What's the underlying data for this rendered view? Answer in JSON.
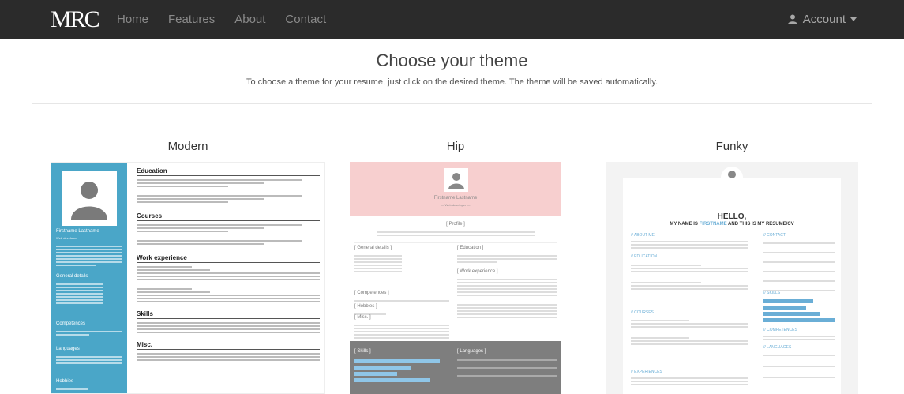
{
  "nav": {
    "brand": "MRC",
    "links": [
      "Home",
      "Features",
      "About",
      "Contact"
    ],
    "account_label": "Account"
  },
  "header": {
    "title": "Choose your theme",
    "subtitle": "To choose a theme for your resume, just click on the desired theme. The theme will be saved automatically."
  },
  "themes": [
    {
      "name": "Modern",
      "preview": {
        "name": "Firstname Lastname",
        "role": "Web developer",
        "sections": [
          "Education",
          "Courses",
          "Work experience",
          "Skills",
          "Misc."
        ],
        "side_sections": [
          "General details",
          "Competences",
          "Languages",
          "Hobbies"
        ],
        "accent": "#4aa6c8"
      }
    },
    {
      "name": "Hip",
      "preview": {
        "name": "Firstname Lastname",
        "role": "— Web developer —",
        "sections": [
          "[ Profile ]",
          "[ General details ]",
          "[ Education ]",
          "[ Work experience ]",
          "[ Competences ]",
          "[ Hobbies ]",
          "[ Misc. ]",
          "[ Skills ]",
          "[ Languages ]"
        ],
        "accent": "#f7cfcf"
      }
    },
    {
      "name": "Funky",
      "preview": {
        "hello": "HELLO,",
        "tagline_pre": "MY NAME IS ",
        "tagline_name": "FIRSTNAME",
        "tagline_post": " AND THIS IS MY RESUME/CV",
        "sections": [
          "// ABOUT ME",
          "// EDUCATION",
          "// COURSES",
          "// EXPERIENCES",
          "// CONTACT",
          "// SKILLS",
          "// COMPETENCES",
          "// LANGUAGES"
        ],
        "accent": "#6aaed6"
      }
    }
  ],
  "colors": {
    "navbar": "#2b2b2b",
    "modern_accent": "#4aa6c8",
    "hip_accent": "#f7cfcf",
    "funky_accent": "#6aaed6"
  }
}
